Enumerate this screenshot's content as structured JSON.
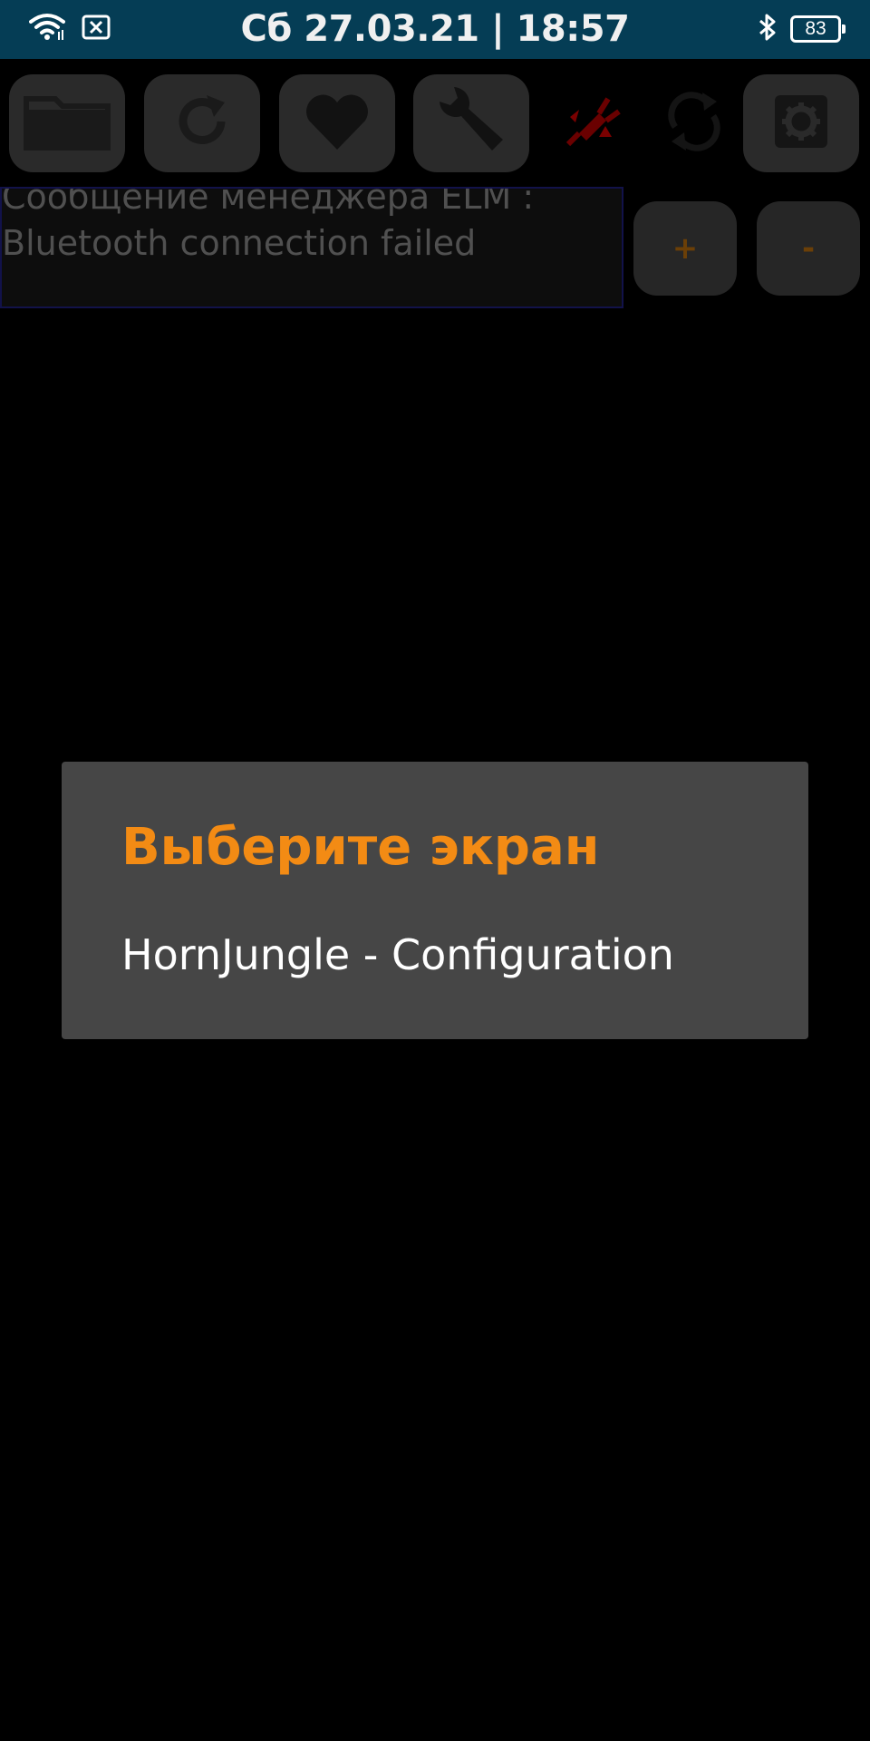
{
  "status_bar": {
    "datetime": "Сб 27.03.21 | 18:57",
    "battery_level": "83",
    "icons": [
      "wifi-icon",
      "sim-off-icon",
      "bluetooth-icon",
      "battery-icon"
    ]
  },
  "toolbar": {
    "buttons": [
      "folder-icon",
      "refresh-icon",
      "heart-icon",
      "wrench-icon",
      "disconnected-plug-icon",
      "sync-icon",
      "gear-icon"
    ]
  },
  "message": {
    "line1": "Сообщение менеджера ELM :",
    "line2": "Bluetooth connection failed"
  },
  "zoom": {
    "plus_label": "+",
    "minus_label": "-"
  },
  "dialog": {
    "title": "Выберите экран",
    "items": [
      "HornJungle - Configuration"
    ]
  },
  "colors": {
    "status_bar_bg": "#053d55",
    "accent_orange": "#f38b14",
    "dialog_bg": "#464646",
    "disconnected_red": "#7a0000"
  }
}
